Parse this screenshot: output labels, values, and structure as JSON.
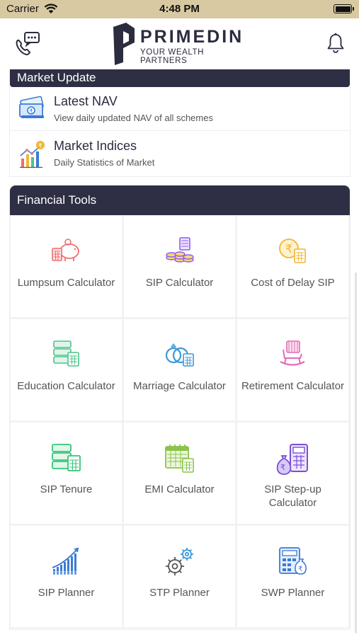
{
  "status_bar": {
    "carrier": "Carrier",
    "time": "4:48 PM"
  },
  "header": {
    "brand_name": "PRIMEDIN",
    "brand_tagline": "YOUR WEALTH PARTNERS",
    "chat_icon": "chat-phone-icon",
    "bell_icon": "bell-icon"
  },
  "market_update": {
    "title": "Market Update",
    "items": [
      {
        "title": "Latest NAV",
        "subtitle": "View daily updated NAV of all schemes",
        "icon": "money-notes-icon"
      },
      {
        "title": "Market Indices",
        "subtitle": "Daily Statistics of Market",
        "icon": "bar-chart-rupee-icon"
      }
    ]
  },
  "financial_tools": {
    "title": "Financial Tools",
    "tools": [
      {
        "label": "Lumpsum Calculator",
        "icon": "piggy-bank-icon",
        "color": "#f06d6d"
      },
      {
        "label": "SIP Calculator",
        "icon": "coins-icon",
        "color": "#8b5cf6"
      },
      {
        "label": "Cost of Delay SIP",
        "icon": "rupee-calculator-icon",
        "color": "#f2b632"
      },
      {
        "label": "Education Calculator",
        "icon": "education-calculator-icon",
        "color": "#4cc38a"
      },
      {
        "label": "Marriage Calculator",
        "icon": "rings-icon",
        "color": "#3b9ad9"
      },
      {
        "label": "Retirement Calculator",
        "icon": "rocking-chair-icon",
        "color": "#e46bb3"
      },
      {
        "label": "SIP Tenure",
        "icon": "tenure-calculator-icon",
        "color": "#35c47a"
      },
      {
        "label": "EMI Calculator",
        "icon": "calendar-calculator-icon",
        "color": "#8bc34a"
      },
      {
        "label": "SIP Step-up Calculator",
        "icon": "moneybag-calculator-icon",
        "color": "#7b4fd6"
      },
      {
        "label": "SIP Planner",
        "icon": "growth-bars-icon",
        "color": "#3a7bd5"
      },
      {
        "label": "STP Planner",
        "icon": "gears-icon",
        "color": "#3b9ad9"
      },
      {
        "label": "SWP Planner",
        "icon": "calculator-moneybag-icon",
        "color": "#3a7bd5"
      }
    ]
  }
}
